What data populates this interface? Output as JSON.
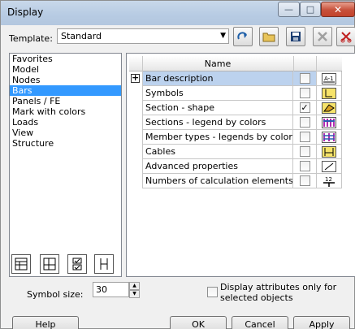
{
  "window": {
    "title": "Display",
    "minimize": "—",
    "maximize": "□",
    "close": "✕"
  },
  "template": {
    "label": "Template:",
    "value": "Standard",
    "arrow": "▼"
  },
  "toolbar": {
    "buttons": [
      "redo-arrow-icon",
      "open-folder-icon",
      "save-disk-icon",
      "delete-x-icon",
      "cut-scissors-icon"
    ]
  },
  "categories": [
    "Favorites",
    "Model",
    "Nodes",
    "Bars",
    "Panels / FE",
    "Mark with colors",
    "Loads",
    "View",
    "Structure"
  ],
  "selected_category": "Bars",
  "bottom_icons": [
    "expand-all-icon",
    "collapse-all-icon",
    "check-all-icon",
    "uncheck-all-icon"
  ],
  "grid": {
    "header": "Name",
    "rows": [
      {
        "expander": "+",
        "label": "Bar description",
        "checked": "",
        "icon": "bar-description-icon"
      },
      {
        "expander": "",
        "label": "Symbols",
        "checked": "",
        "icon": "symbols-icon"
      },
      {
        "expander": "",
        "label": "Section - shape",
        "checked": "✓",
        "icon": "section-shape-icon"
      },
      {
        "expander": "",
        "label": "Sections - legend by colors",
        "checked": "",
        "icon": "sections-legend-icon"
      },
      {
        "expander": "",
        "label": "Member types - legends by colors",
        "checked": "",
        "icon": "member-types-legend-icon"
      },
      {
        "expander": "",
        "label": "Cables",
        "checked": "",
        "icon": "cables-icon"
      },
      {
        "expander": "",
        "label": "Advanced properties",
        "checked": "",
        "icon": "advanced-properties-icon"
      },
      {
        "expander": "",
        "label": "Numbers of calculation elements",
        "checked": "",
        "icon": "calc-element-numbers-icon"
      }
    ]
  },
  "symbol_size": {
    "label": "Symbol size:",
    "value": "30",
    "up": "▲",
    "down": "▼"
  },
  "display_attrs": {
    "label": "Display attributes only for selected objects"
  },
  "buttons": {
    "help": "Help",
    "ok": "OK",
    "cancel": "Cancel",
    "apply": "Apply"
  },
  "colors": {
    "selection": "#3399ff",
    "row_highlight": "#bcd2ee",
    "titlebar": "#b9cce3"
  }
}
